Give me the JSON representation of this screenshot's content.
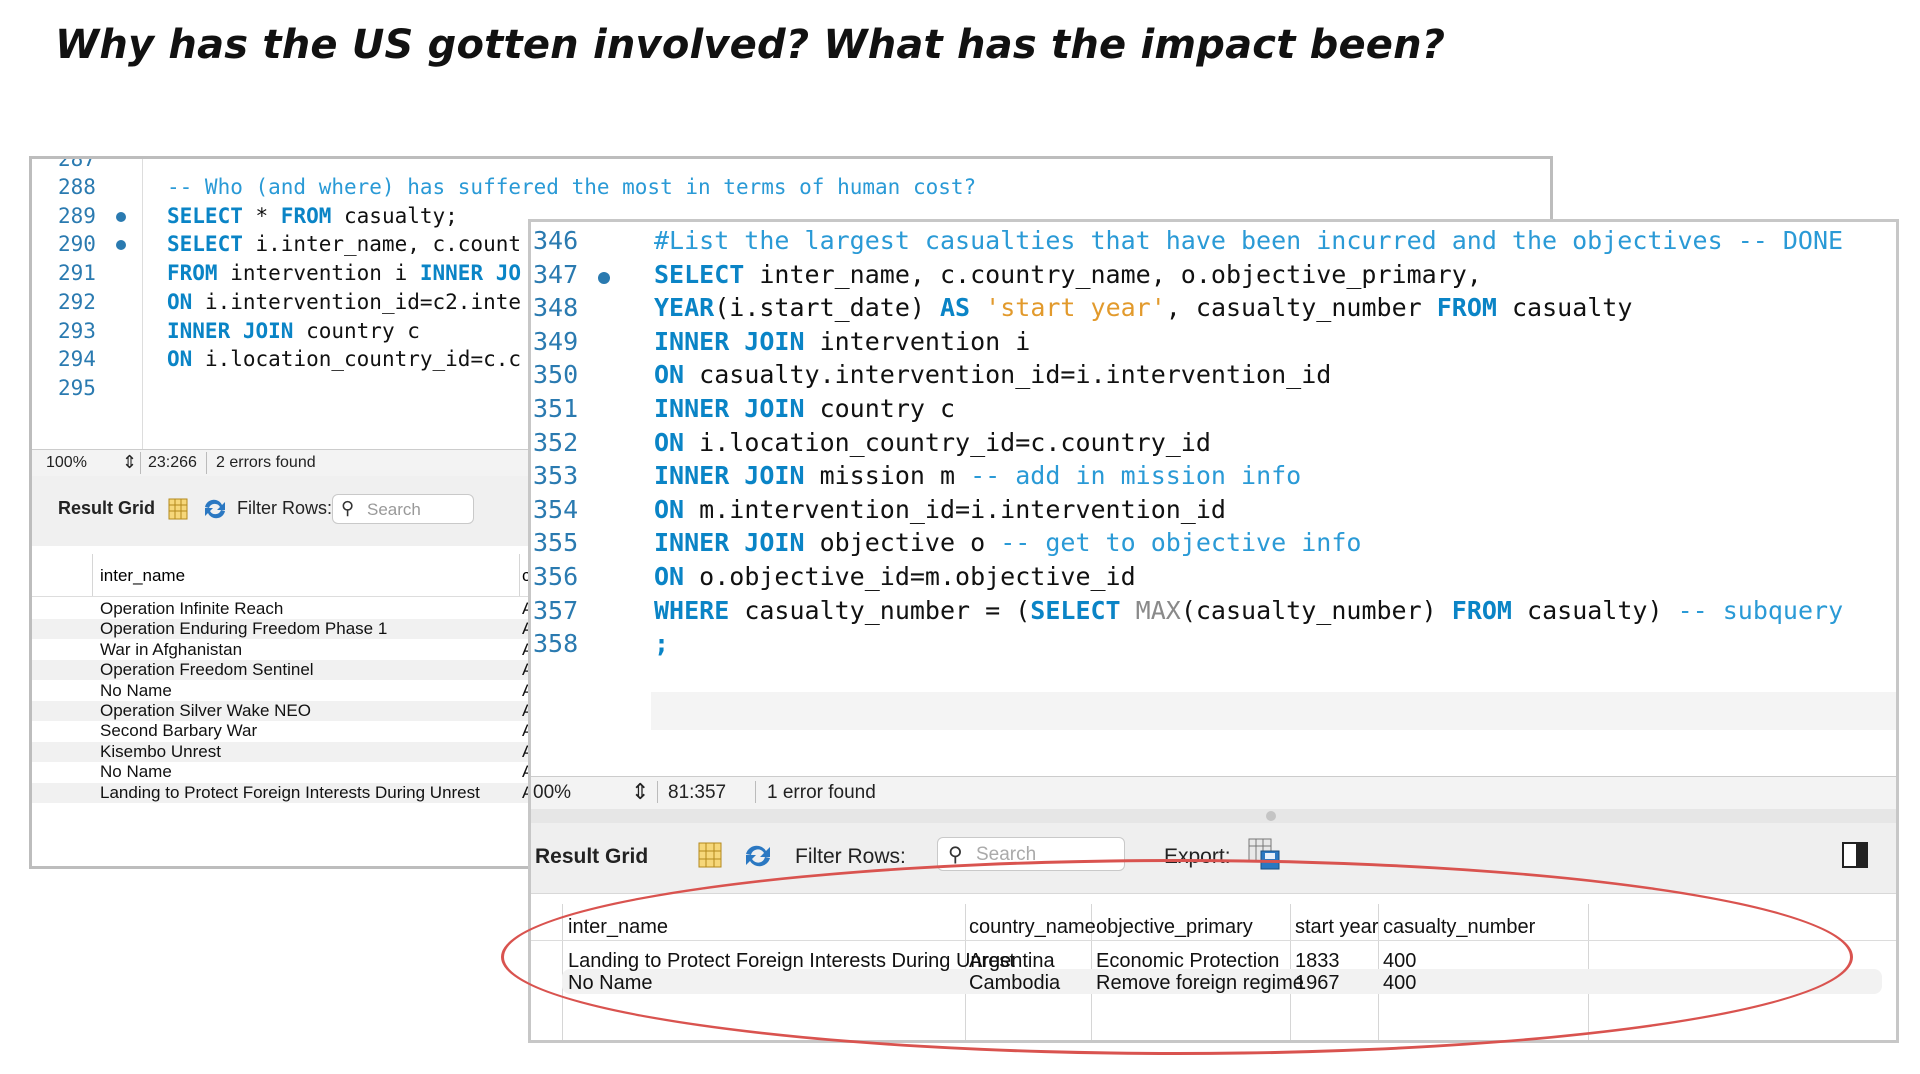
{
  "slide": {
    "title": "Why has the US gotten involved? What has the impact been?"
  },
  "back_window": {
    "partial_top_line": "287",
    "lines": [
      {
        "num": "288",
        "bp": false,
        "parts": [
          {
            "t": "-- Who (and where) has suffered the most in terms of human cost?",
            "c": "cm"
          }
        ]
      },
      {
        "num": "289",
        "bp": true,
        "parts": [
          {
            "t": "SELECT",
            "c": "kw"
          },
          {
            "t": " * ",
            "c": ""
          },
          {
            "t": "FROM",
            "c": "kw"
          },
          {
            "t": " casualty;",
            "c": ""
          }
        ]
      },
      {
        "num": "290",
        "bp": true,
        "parts": [
          {
            "t": "SELECT",
            "c": "kw"
          },
          {
            "t": " i.inter_name, c.count",
            "c": ""
          }
        ]
      },
      {
        "num": "291",
        "bp": false,
        "parts": [
          {
            "t": "FROM",
            "c": "kw"
          },
          {
            "t": " intervention i ",
            "c": ""
          },
          {
            "t": "INNER JO",
            "c": "kw"
          }
        ]
      },
      {
        "num": "292",
        "bp": false,
        "parts": [
          {
            "t": "ON",
            "c": "kw"
          },
          {
            "t": " i.intervention_id=c2.inte",
            "c": ""
          }
        ]
      },
      {
        "num": "293",
        "bp": false,
        "parts": [
          {
            "t": "INNER JOIN",
            "c": "kw"
          },
          {
            "t": " country c",
            "c": ""
          }
        ]
      },
      {
        "num": "294",
        "bp": false,
        "parts": [
          {
            "t": "ON",
            "c": "kw"
          },
          {
            "t": " i.location_country_id=c.c",
            "c": ""
          }
        ]
      },
      {
        "num": "295",
        "bp": false,
        "parts": []
      }
    ],
    "status": {
      "zoom": "100%",
      "position": "23:266",
      "errors": "2 errors found"
    },
    "toolbar": {
      "result_grid": "Result Grid",
      "filter_rows": "Filter Rows:",
      "search_placeholder": "Search"
    },
    "grid": {
      "header": "inter_name",
      "header_second_partial": "c",
      "rows": [
        "Operation Infinite Reach",
        "Operation Enduring Freedom Phase 1",
        "War in Afghanistan",
        "Operation Freedom Sentinel",
        "No Name",
        "Operation Silver Wake NEO",
        "Second Barbary War",
        "Kisembo Unrest",
        "No Name",
        "Landing to Protect Foreign Interests During Unrest"
      ],
      "second_col_partial": "A"
    }
  },
  "front_window": {
    "lines": [
      {
        "num": "346",
        "bp": false,
        "parts": [
          {
            "t": "#List the largest casualties that have been incurred and the objectives -- DONE",
            "c": "cm"
          }
        ]
      },
      {
        "num": "347",
        "bp": true,
        "parts": [
          {
            "t": "SELECT",
            "c": "kw"
          },
          {
            "t": " inter_name, c.country_name, o.objective_primary,",
            "c": ""
          }
        ]
      },
      {
        "num": "348",
        "bp": false,
        "parts": [
          {
            "t": "YEAR",
            "c": "kw"
          },
          {
            "t": "(i.start_date) ",
            "c": ""
          },
          {
            "t": "AS",
            "c": "kw"
          },
          {
            "t": " ",
            "c": ""
          },
          {
            "t": "'start year'",
            "c": "st"
          },
          {
            "t": ", casualty_number ",
            "c": ""
          },
          {
            "t": "FROM",
            "c": "kw"
          },
          {
            "t": " casualty",
            "c": ""
          }
        ]
      },
      {
        "num": "349",
        "bp": false,
        "parts": [
          {
            "t": "INNER JOIN",
            "c": "kw"
          },
          {
            "t": " intervention i",
            "c": ""
          }
        ]
      },
      {
        "num": "350",
        "bp": false,
        "parts": [
          {
            "t": "ON",
            "c": "kw"
          },
          {
            "t": " casualty.intervention_id=i.intervention_id",
            "c": ""
          }
        ]
      },
      {
        "num": "351",
        "bp": false,
        "parts": [
          {
            "t": "INNER JOIN",
            "c": "kw"
          },
          {
            "t": " country c",
            "c": ""
          }
        ]
      },
      {
        "num": "352",
        "bp": false,
        "parts": [
          {
            "t": "ON",
            "c": "kw"
          },
          {
            "t": " i.location_country_id=c.country_id",
            "c": ""
          }
        ]
      },
      {
        "num": "353",
        "bp": false,
        "parts": [
          {
            "t": "INNER JOIN",
            "c": "kw"
          },
          {
            "t": " mission m ",
            "c": ""
          },
          {
            "t": "-- add in mission info",
            "c": "cm"
          }
        ]
      },
      {
        "num": "354",
        "bp": false,
        "parts": [
          {
            "t": "ON",
            "c": "kw"
          },
          {
            "t": " m.intervention_id=i.intervention_id",
            "c": ""
          }
        ]
      },
      {
        "num": "355",
        "bp": false,
        "parts": [
          {
            "t": "INNER JOIN",
            "c": "kw"
          },
          {
            "t": " objective o ",
            "c": ""
          },
          {
            "t": "-- get to objective info",
            "c": "cm"
          }
        ]
      },
      {
        "num": "356",
        "bp": false,
        "parts": [
          {
            "t": "ON",
            "c": "kw"
          },
          {
            "t": " o.objective_id=m.objective_id",
            "c": ""
          }
        ]
      },
      {
        "num": "357",
        "bp": false,
        "parts": [
          {
            "t": "WHERE",
            "c": "kw"
          },
          {
            "t": " casualty_number = (",
            "c": ""
          },
          {
            "t": "SELECT",
            "c": "kw"
          },
          {
            "t": " ",
            "c": ""
          },
          {
            "t": "MAX",
            "c": "fn"
          },
          {
            "t": "(casualty_number) ",
            "c": ""
          },
          {
            "t": "FROM",
            "c": "kw"
          },
          {
            "t": " casualty) ",
            "c": ""
          },
          {
            "t": "-- subquery",
            "c": "cm"
          }
        ]
      },
      {
        "num": "358",
        "bp": false,
        "parts": [
          {
            "t": ";",
            "c": "kw"
          }
        ]
      }
    ],
    "status": {
      "zoom": "00%",
      "position": "81:357",
      "errors": "1 error found"
    },
    "toolbar": {
      "result_grid": "Result Grid",
      "filter_rows": "Filter Rows:",
      "search_placeholder": "Search",
      "export": "Export:"
    },
    "grid": {
      "headers": [
        "inter_name",
        "country_name",
        "objective_primary",
        "start year",
        "casualty_number"
      ],
      "rows": [
        [
          "Landing to Protect Foreign Interests During Unrest",
          "Argentina",
          "Economic Protection",
          "1833",
          "400"
        ],
        [
          "No Name",
          "Cambodia",
          "Remove foreign regime",
          "1967",
          "400"
        ]
      ]
    }
  },
  "colors": {
    "keyword": "#0a84c6",
    "comment": "#2a9ad6",
    "string": "#e29a2c",
    "line_number": "#2a7ab0",
    "highlight_ellipse": "#d9534f"
  }
}
